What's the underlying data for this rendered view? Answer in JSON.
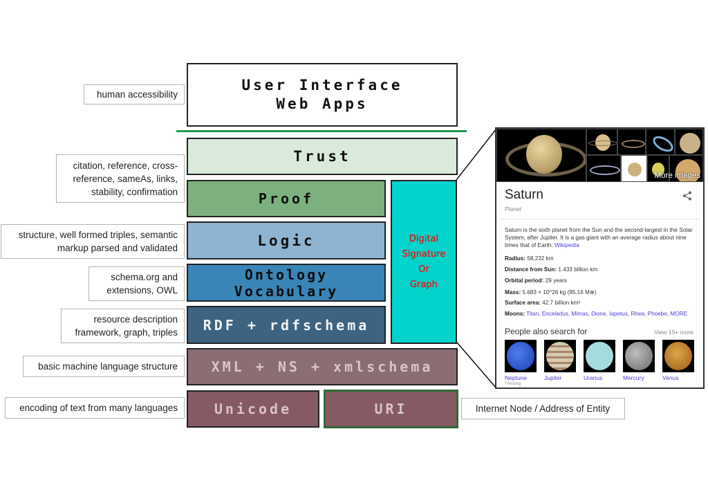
{
  "stack": {
    "user_interface": "User Interface\nWeb Apps",
    "trust": "Trust",
    "proof": "Proof",
    "logic": "Logic",
    "ontology": "Ontology Vocabulary",
    "rdf": "RDF + rdfschema",
    "xml": "XML + NS + xmlschema",
    "unicode": "Unicode",
    "uri": "URI",
    "signature": "Digital\nSignature\nOr\nGraph"
  },
  "notes": {
    "human_accessibility": "human accessibility",
    "trust_proof": "citation, reference, cross-\nreference, sameAs, links,\nstability, confirmation",
    "logic": "structure, well formed triples, semantic\nmarkup parsed and validated",
    "ontology": "schema.org and\nextensions, OWL",
    "rdf": "resource description\nframework, graph, triples",
    "xml": "basic machine language structure",
    "unicode": "encoding of text from many languages",
    "uri": "Internet Node / Address of Entity"
  },
  "colors": {
    "divider": "#1e9a55",
    "trust": "#d9eadb",
    "proof": "#7db07f",
    "logic": "#8fb4d1",
    "ontology": "#3a85b7",
    "rdf": "#3d6381",
    "xml": "#8a6e73",
    "unicode_uri": "#865a62",
    "signature": "#02d3cb",
    "signature_text": "#e01010",
    "link": "#4a3ed6"
  },
  "knowledge_panel": {
    "more_images": "More images",
    "title": "Saturn",
    "subtitle": "Planet",
    "share_icon": "share-icon",
    "description": "Saturn is the sixth planet from the Sun and the second-largest in the Solar System, after Jupiter. It is a gas giant with an average radius about nine times that of Earth.",
    "wiki_link": "Wikipedia",
    "facts": [
      {
        "label": "Radius:",
        "value": "58,232 km"
      },
      {
        "label": "Distance from Sun:",
        "value": "1.433 billion km"
      },
      {
        "label": "Orbital period:",
        "value": "29 years"
      },
      {
        "label": "Mass:",
        "value": "5.683 × 10^26 kg (95.16 M⊕)"
      },
      {
        "label": "Surface area:",
        "value": "42.7 billion km²"
      }
    ],
    "moons_label": "Moons:",
    "moons": "Titan, Enceladus, Mimas, Dione, Iapetus, Rhea, Phoebe, MORE",
    "people_also_search": "People also search for",
    "view_more": "View 15+ more",
    "related": [
      {
        "name": "Neptune",
        "color": "#2e5ce0"
      },
      {
        "name": "Jupiter",
        "color": "#c8b69a"
      },
      {
        "name": "Uranus",
        "color": "#a6dcdf"
      },
      {
        "name": "Mercury",
        "color": "#9a9a9a"
      },
      {
        "name": "Venus",
        "color": "#c98a2a"
      }
    ],
    "trending": "Trending"
  }
}
